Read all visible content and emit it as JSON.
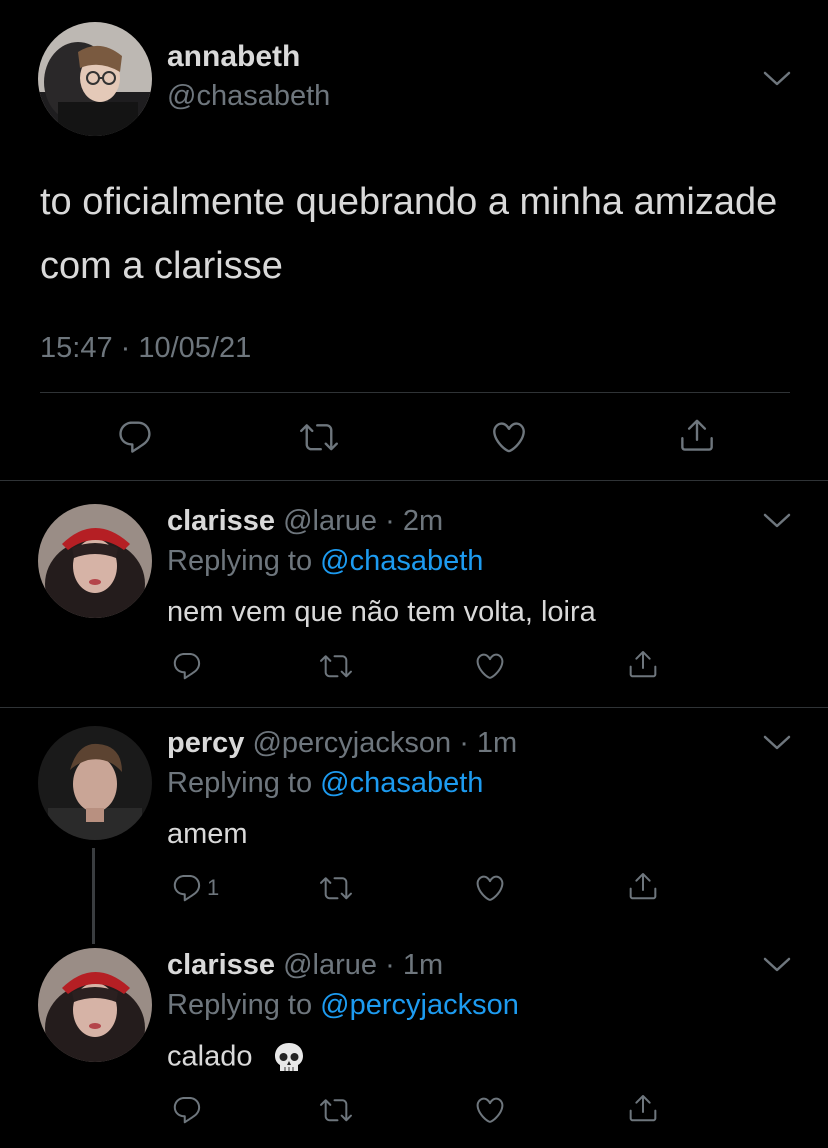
{
  "main_tweet": {
    "name": "annabeth",
    "handle": "@chasabeth",
    "text": "to oficialmente quebrando a minha amizade com a clarisse",
    "timestamp": "15:47 · 10/05/21"
  },
  "replies": [
    {
      "name": "clarisse",
      "handle": "@larue",
      "time": "2m",
      "replying_prefix": "Replying to ",
      "replying_to": "@chasabeth",
      "text": "nem vem que não tem volta, loira",
      "reply_count": ""
    },
    {
      "name": "percy",
      "handle": "@percyjackson",
      "time": "1m",
      "replying_prefix": "Replying to ",
      "replying_to": "@chasabeth",
      "text": "amem",
      "reply_count": "1"
    },
    {
      "name": "clarisse",
      "handle": "@larue",
      "time": "1m",
      "replying_prefix": "Replying to ",
      "replying_to": "@percyjackson",
      "text": "calado",
      "emoji": "skull-emoji",
      "reply_count": ""
    }
  ],
  "separator": " · ",
  "icons": {
    "reply": "reply-icon",
    "retweet": "retweet-icon",
    "like": "like-icon",
    "share": "share-icon",
    "more": "chevron-down-icon"
  },
  "colors": {
    "background": "#000000",
    "text": "#d9d9d9",
    "muted": "#6e767d",
    "accent": "#1d9bf0",
    "divider": "#2f3336"
  }
}
